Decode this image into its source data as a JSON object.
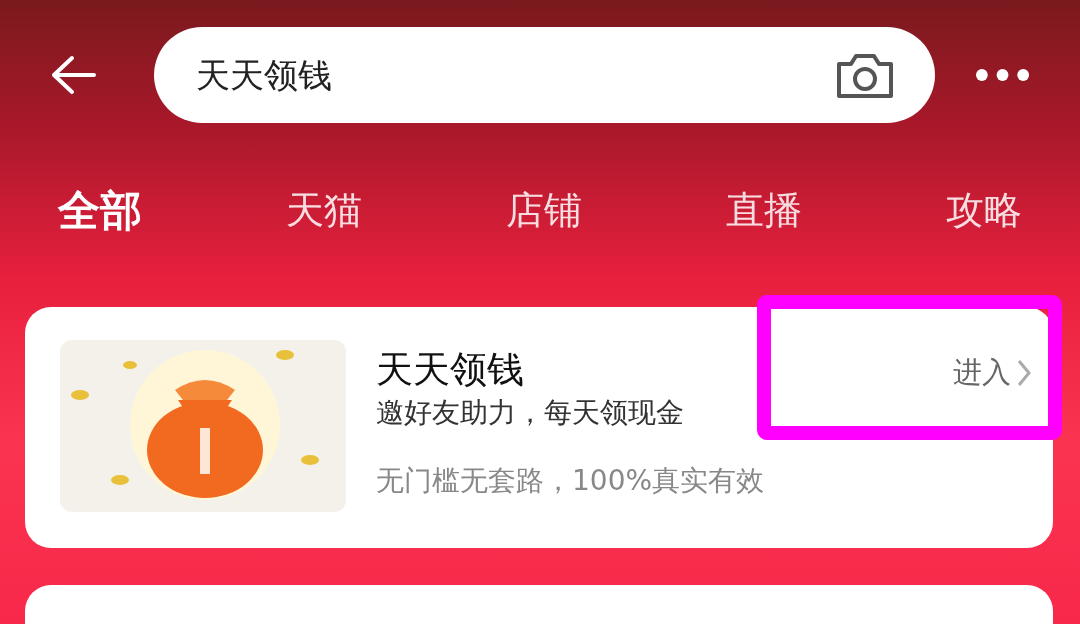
{
  "search": {
    "value": "天天领钱"
  },
  "tabs": [
    {
      "label": "全部",
      "selected": true
    },
    {
      "label": "天猫",
      "selected": false
    },
    {
      "label": "店铺",
      "selected": false
    },
    {
      "label": "直播",
      "selected": false
    },
    {
      "label": "攻略",
      "selected": false
    }
  ],
  "result": {
    "title": "天天领钱",
    "subtitle": "邀好友助力，每天领现金",
    "note": "无门槛无套路，100%真实有效",
    "action": "进入"
  }
}
